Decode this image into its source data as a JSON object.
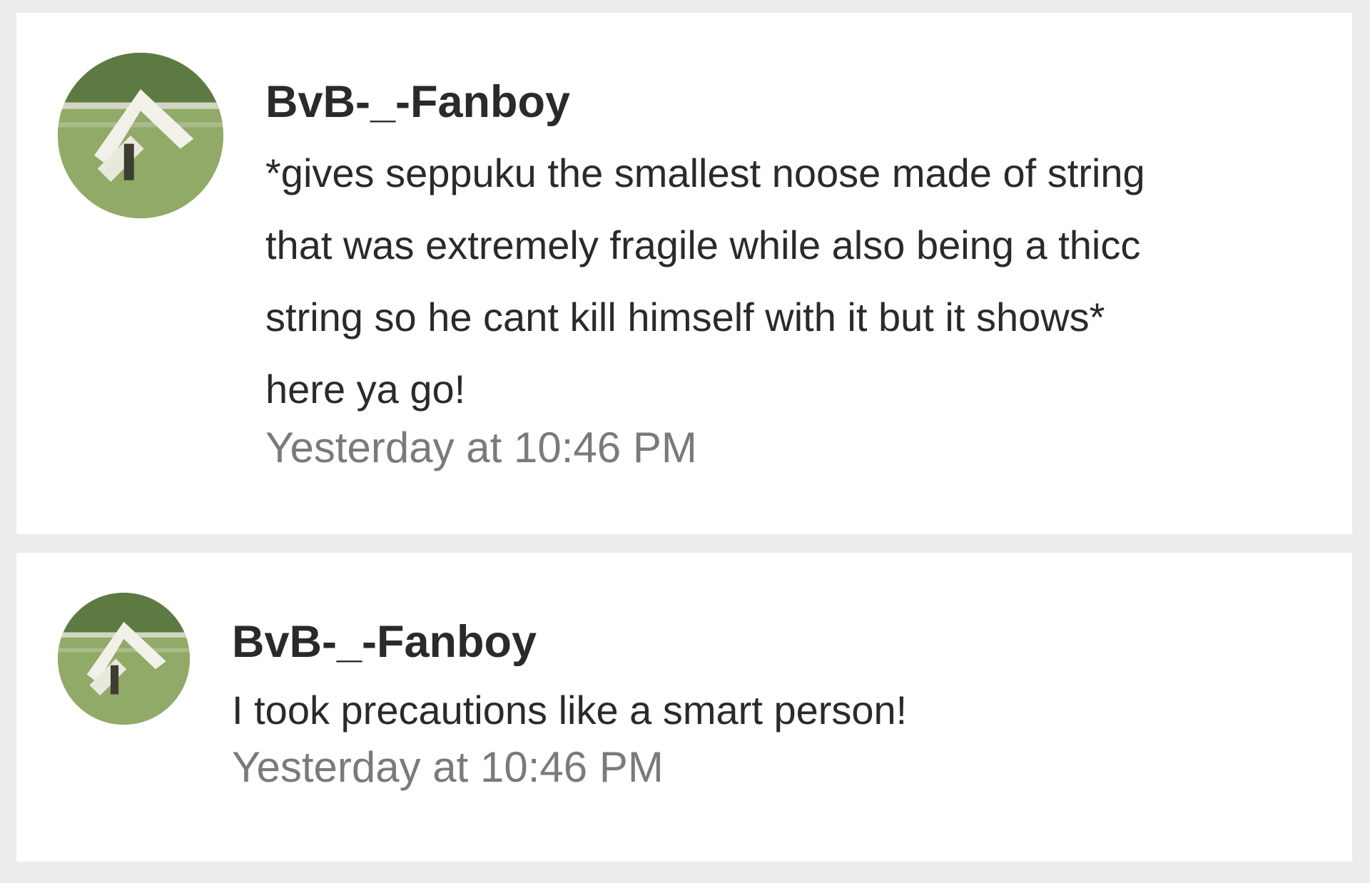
{
  "comments": [
    {
      "username": "BvB-_-Fanboy",
      "message": "*gives seppuku the smallest noose made of string\nthat was extremely fragile while also being a thicc\nstring so he cant kill himself with it but it shows*\nhere ya go!",
      "timestamp": "Yesterday at 10:46 PM"
    },
    {
      "username": "BvB-_-Fanboy",
      "message": "I took precautions like a smart person!",
      "timestamp": "Yesterday at 10:46 PM"
    }
  ],
  "colors": {
    "background": "#ececec",
    "card": "#ffffff",
    "username": "#2a2a2a",
    "message": "#2a2a2a",
    "timestamp": "#7a7a7a"
  },
  "icons": {
    "avatar": "avatar-icon"
  }
}
